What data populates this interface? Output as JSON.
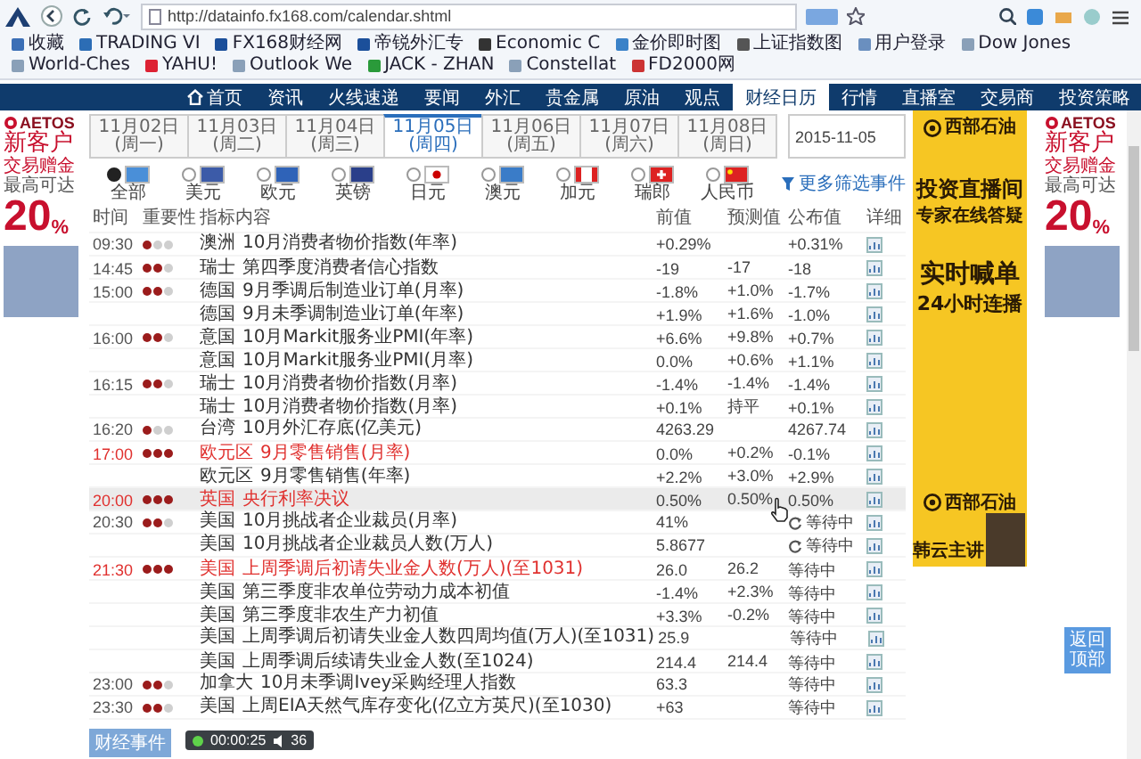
{
  "browser": {
    "url": "http://datainfo.fx168.com/calendar.shtml",
    "bookmarks": [
      "收藏",
      "TRADING VI",
      "FX168财经网",
      "帝锐外汇专",
      "Economic C",
      "金价即时图",
      "上证指数图",
      "用户登录",
      "Dow Jones",
      "World-Ches",
      "YAHU!",
      "Outlook We",
      "JACK - ZHAN",
      "Constellat",
      "FD2000网"
    ]
  },
  "nav": [
    {
      "label": "首页",
      "selected": false
    },
    {
      "label": "资讯",
      "selected": false
    },
    {
      "label": "火线速递",
      "selected": false
    },
    {
      "label": "要闻",
      "selected": false
    },
    {
      "label": "外汇",
      "selected": false
    },
    {
      "label": "贵金属",
      "selected": false
    },
    {
      "label": "原油",
      "selected": false
    },
    {
      "label": "观点",
      "selected": false
    },
    {
      "label": "财经日历",
      "selected": true
    },
    {
      "label": "行情",
      "selected": false
    },
    {
      "label": "直播室",
      "selected": false
    },
    {
      "label": "交易商",
      "selected": false
    },
    {
      "label": "投资策略",
      "selected": false
    }
  ],
  "left_ad": {
    "brand": "AETOS",
    "headline": "新客户",
    "line_2": "交易赠金",
    "line_3": "最高可达",
    "offer": "20",
    "offer_unit": "%"
  },
  "calendar": {
    "date_tabs": [
      {
        "label": "11月02日(周一)",
        "selected": false
      },
      {
        "label": "11月03日(周二)",
        "selected": false
      },
      {
        "label": "11月04日(周三)",
        "selected": false
      },
      {
        "label": "11月05日(周四)",
        "selected": true
      },
      {
        "label": "11月06日(周五)",
        "selected": false
      },
      {
        "label": "11月07日(周六)",
        "selected": false
      },
      {
        "label": "11月08日(周日)",
        "selected": false
      }
    ],
    "date_field": {
      "value": "2015-11-05"
    },
    "filters": [
      {
        "label": "全部",
        "selected": true
      },
      {
        "label": "美元",
        "selected": false
      },
      {
        "label": "欧元",
        "selected": false
      },
      {
        "label": "英镑",
        "selected": false
      },
      {
        "label": "日元",
        "selected": false
      },
      {
        "label": "澳元",
        "selected": false
      },
      {
        "label": "加元",
        "selected": false
      },
      {
        "label": "瑞郎",
        "selected": false
      },
      {
        "label": "人民币",
        "selected": false
      }
    ],
    "more_filters": "更多筛选事件",
    "columns": [
      "时间",
      "重要性",
      "指标内容",
      "前值",
      "预测值",
      "公布值",
      "详细"
    ],
    "rows": [
      {
        "time": "09:30",
        "stars": 1,
        "country": "澳洲",
        "indicator": "10月消费者物价指数(年率)",
        "previous": "+0.29%",
        "actual": "+0.31%",
        "important": false,
        "hovered": false,
        "loading": false
      },
      {
        "time": "14:45",
        "stars": 2,
        "country": "瑞士",
        "indicator": "第四季度消费者信心指数",
        "previous": "-19",
        "forecast": "-17",
        "actual": "-18",
        "important": false,
        "hovered": false,
        "loading": false
      },
      {
        "time": "15:00",
        "stars": 2,
        "country": "德国",
        "indicator": "9月季调后制造业订单(月率)",
        "previous": "-1.8%",
        "forecast": "+1.0%",
        "actual": "-1.7%",
        "important": false,
        "hovered": false,
        "loading": false
      },
      {
        "country": "德国",
        "indicator": "9月未季调制造业订单(年率)",
        "previous": "+1.9%",
        "forecast": "+1.6%",
        "actual": "-1.0%",
        "important": false,
        "hovered": false,
        "loading": false
      },
      {
        "time": "16:00",
        "stars": 2,
        "country": "意国",
        "indicator": "10月Markit服务业PMI(年率)",
        "previous": "+6.6%",
        "forecast": "+9.8%",
        "actual": "+0.7%",
        "important": false,
        "hovered": false,
        "loading": false
      },
      {
        "country": "意国",
        "indicator": "10月Markit服务业PMI(月率)",
        "previous": "0.0%",
        "forecast": "+0.6%",
        "actual": "+1.1%",
        "important": false,
        "hovered": false,
        "loading": false
      },
      {
        "time": "16:15",
        "stars": 2,
        "country": "瑞士",
        "indicator": "10月消费者物价指数(月率)",
        "previous": "-1.4%",
        "forecast": "-1.4%",
        "actual": "-1.4%",
        "important": false,
        "hovered": false,
        "loading": false
      },
      {
        "country": "瑞士",
        "indicator": "10月消费者物价指数(月率)",
        "previous": "+0.1%",
        "forecast": "持平",
        "actual": "+0.1%",
        "important": false,
        "hovered": false,
        "loading": false
      },
      {
        "time": "16:20",
        "stars": 1,
        "country": "台湾",
        "indicator": "10月外汇存底(亿美元)",
        "previous": "4263.29",
        "actual": "4267.74",
        "important": false,
        "hovered": false,
        "loading": false
      },
      {
        "time": "17:00",
        "stars": 3,
        "country": "欧元区",
        "indicator": "9月零售销售(月率)",
        "previous": "0.0%",
        "forecast": "+0.2%",
        "actual": "-0.1%",
        "important": true,
        "hovered": false,
        "loading": false
      },
      {
        "country": "欧元区",
        "indicator": "9月零售销售(年率)",
        "previous": "+2.2%",
        "forecast": "+3.0%",
        "actual": "+2.9%",
        "important": false,
        "hovered": false,
        "loading": false
      },
      {
        "time": "20:00",
        "stars": 3,
        "country": "英国",
        "indicator": "央行利率决议",
        "previous": "0.50%",
        "forecast": "0.50%",
        "actual": "0.50%",
        "important": true,
        "hovered": true,
        "loading": false
      },
      {
        "time": "20:30",
        "stars": 2,
        "country": "美国",
        "indicator": "10月挑战者企业裁员(月率)",
        "previous": "41%",
        "actual": "等待中",
        "important": false,
        "hovered": false,
        "loading": true
      },
      {
        "country": "美国",
        "indicator": "10月挑战者企业裁员人数(万人)",
        "previous": "5.8677",
        "actual": "等待中",
        "important": false,
        "hovered": false,
        "loading": true
      },
      {
        "time": "21:30",
        "stars": 3,
        "country": "美国",
        "indicator": "上周季调后初请失业金人数(万人)(至1031)",
        "previous": "26.0",
        "forecast": "26.2",
        "actual": "等待中",
        "important": true,
        "hovered": false,
        "loading": false
      },
      {
        "country": "美国",
        "indicator": "第三季度非农单位劳动力成本初值",
        "previous": "-1.4%",
        "forecast": "+2.3%",
        "actual": "等待中",
        "important": false,
        "hovered": false,
        "loading": false
      },
      {
        "country": "美国",
        "indicator": "第三季度非农生产力初值",
        "previous": "+3.3%",
        "forecast": "-0.2%",
        "actual": "等待中",
        "important": false,
        "hovered": false,
        "loading": false
      },
      {
        "country": "美国",
        "indicator": "上周季调后初请失业金人数四周均值(万人)(至1031)",
        "previous": "25.9",
        "actual": "等待中",
        "important": false,
        "hovered": false,
        "loading": false
      },
      {
        "country": "美国",
        "indicator": "上周季调后续请失业金人数(至1024)",
        "previous": "214.4",
        "forecast": "214.4",
        "actual": "等待中",
        "important": false,
        "hovered": false,
        "loading": false
      },
      {
        "time": "23:00",
        "stars": 2,
        "country": "加拿大",
        "indicator": "10月未季调Ivey采购经理人指数",
        "previous": "63.3",
        "actual": "等待中",
        "important": false,
        "hovered": false,
        "loading": false
      },
      {
        "time": "23:30",
        "stars": 2,
        "country": "美国",
        "indicator": "上周EIA天然气库存变化(亿立方英尺)(至1030)",
        "previous": "+63",
        "actual": "等待中",
        "important": false,
        "hovered": false,
        "loading": false
      }
    ],
    "events_tab": "财经事件"
  },
  "center_ad": {
    "logo": "西部石油",
    "headline": "投资直播间",
    "subline": "专家在线答疑",
    "headline_2": "实时喊单",
    "subline_2": "24小时连播",
    "logo_2": "西部石油",
    "host": "韩云主讲"
  },
  "right_ad": {
    "brand": "AETOS",
    "headline": "新客户",
    "line_2": "交易赠金",
    "line_3": "最高可达",
    "offer": "20",
    "offer_unit": "%"
  },
  "back_to_top": "返回顶部",
  "recorder": {
    "time": "00:00:25",
    "count": "36"
  }
}
